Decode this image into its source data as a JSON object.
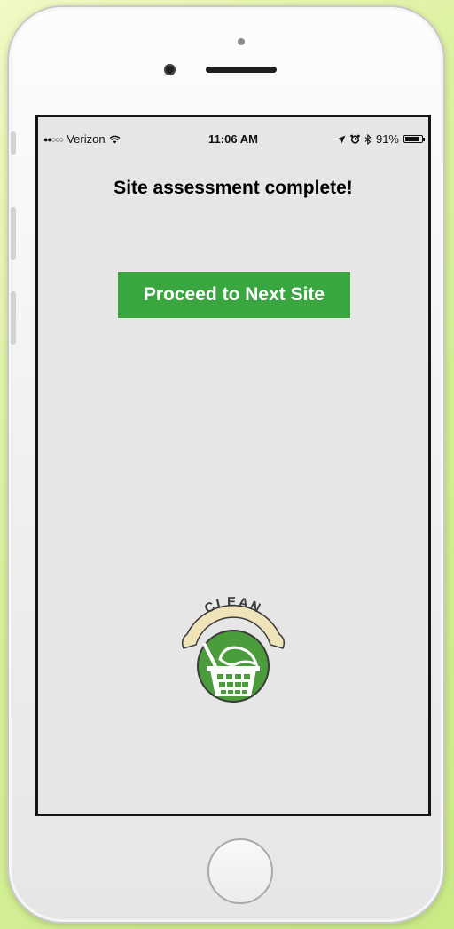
{
  "status_bar": {
    "signal": "●●○○○",
    "carrier": "Verizon",
    "wifi_icon": "wifi-icon",
    "time": "11:06 AM",
    "location_icon": "location-arrow-icon",
    "alarm_icon": "alarm-icon",
    "bluetooth_icon": "bluetooth-icon",
    "battery_percent": "91%",
    "battery_level": 0.91
  },
  "main": {
    "title": "Site assessment complete!",
    "proceed_label": "Proceed to Next Site"
  },
  "logo": {
    "text": "CLEAN",
    "colors": {
      "green": "#4a9d3a",
      "cream": "#efe3b8",
      "dark": "#3b3b3b"
    }
  },
  "colors": {
    "accent": "#3aa640",
    "screen_bg": "#e6e6e6"
  }
}
